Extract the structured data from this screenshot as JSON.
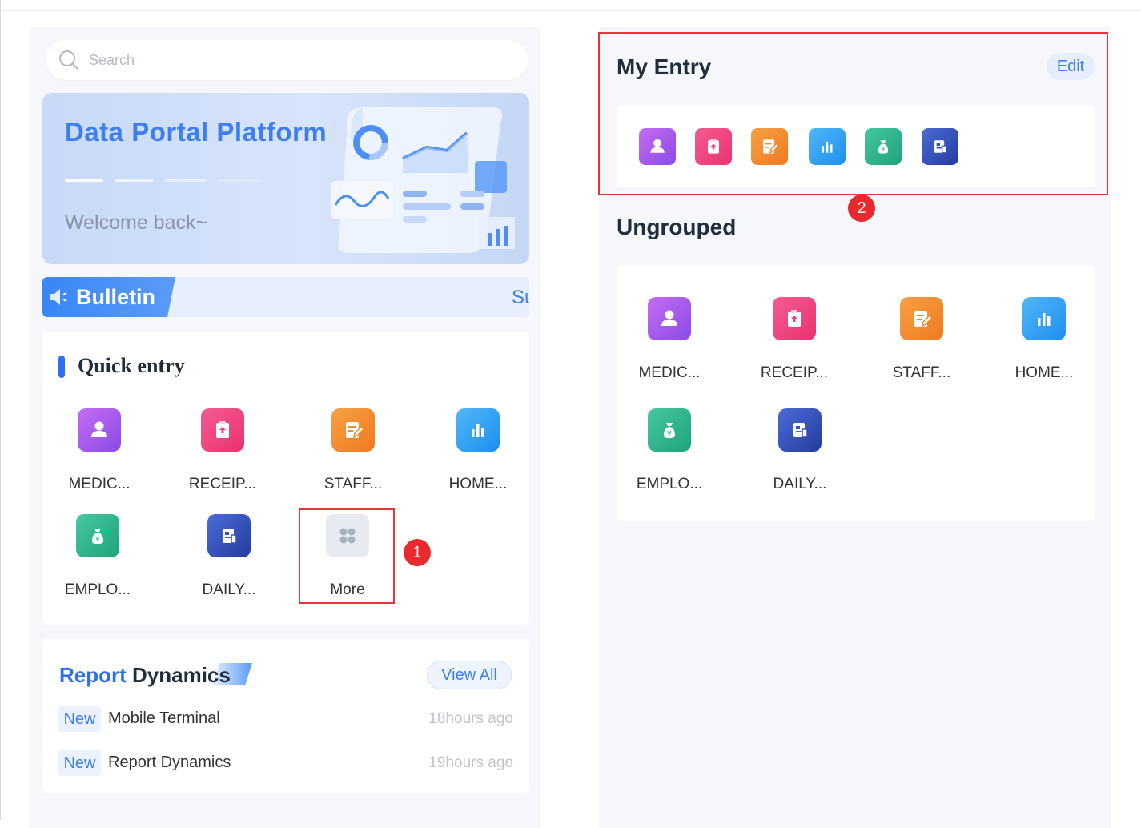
{
  "search": {
    "placeholder": "Search",
    "icon": "search-icon"
  },
  "banner": {
    "title": "Data Portal Platform",
    "subtitle": "Welcome back~"
  },
  "bulletin": {
    "label": "Bulletin",
    "text": "Su"
  },
  "quick_entry": {
    "title": "Quick entry",
    "items": [
      {
        "label": "MEDIC...",
        "icon": "user-icon",
        "color": "#a45cee"
      },
      {
        "label": "RECEIP...",
        "icon": "clipboard-upload-icon",
        "color": "#ef4580"
      },
      {
        "label": "STAFF...",
        "icon": "edit-document-icon",
        "color": "#f28a32"
      },
      {
        "label": "HOME...",
        "icon": "bar-chart-icon",
        "color": "#2fa1f2"
      },
      {
        "label": "EMPLO...",
        "icon": "money-bag-icon",
        "color": "#2fb58d"
      },
      {
        "label": "DAILY...",
        "icon": "report-icon",
        "color": "#3452be"
      },
      {
        "label": "More",
        "icon": "grid-icon",
        "color": "#e7ebf1"
      }
    ]
  },
  "annotations": {
    "badge1": "1",
    "badge2": "2"
  },
  "report": {
    "title_part1": "Report",
    "title_part2": "Dynamics",
    "view_all": "View All",
    "rows": [
      {
        "tag": "New",
        "text": "Mobile Terminal",
        "time": "18hours ago"
      },
      {
        "tag": "New",
        "text": "Report Dynamics",
        "time": "19hours ago"
      }
    ]
  },
  "my_entry": {
    "title": "My Entry",
    "edit": "Edit",
    "icons": [
      "user-icon",
      "clipboard-upload-icon",
      "edit-document-icon",
      "bar-chart-icon",
      "money-bag-icon",
      "report-icon"
    ]
  },
  "ungrouped": {
    "title": "Ungrouped",
    "items": [
      {
        "label": "MEDIC..."
      },
      {
        "label": "RECEIP..."
      },
      {
        "label": "STAFF..."
      },
      {
        "label": "HOME..."
      },
      {
        "label": "EMPLO..."
      },
      {
        "label": "DAILY..."
      }
    ]
  }
}
